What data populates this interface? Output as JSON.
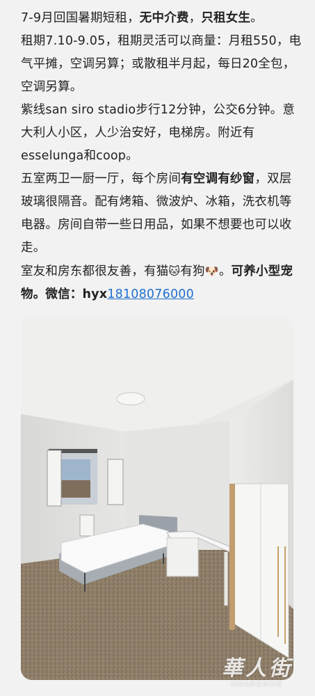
{
  "post": {
    "para1_a": "7-9月回国暑期短租，",
    "para1_b": "无中介费",
    "para1_c": "，",
    "para1_d": "只租女生",
    "para1_e": "。",
    "para2": "租期7.10-9.05，租期灵活可以商量：月租550，电气平摊，空调另算；或散租半月起，每日20全包，空调另算。",
    "para3": "紫线san siro stadio步行12分钟，公交6分钟。意大利人小区，人少治安好，电梯房。附近有esselunga和coop。",
    "para4_a": "五室两卫一厨一厅，每个房间",
    "para4_b": "有空调有纱窗",
    "para4_c": "，双层玻璃很隔音。配有烤箱、微波炉、冰箱，洗衣机等电器。房间自带一些日用品，如果不想要也可以收走。",
    "para5_a": "室友和房东都很友善，有猫",
    "para5_cat": "🐱",
    "para5_b": "有狗",
    "para5_dog": "🐶",
    "para5_c": "。",
    "para5_d": "可养小型宠物。微信：",
    "wechat_prefix": "hyx",
    "wechat_number": "18108076000"
  },
  "watermark": {
    "chinese": "華人街",
    "english": "HUARENJIE"
  }
}
